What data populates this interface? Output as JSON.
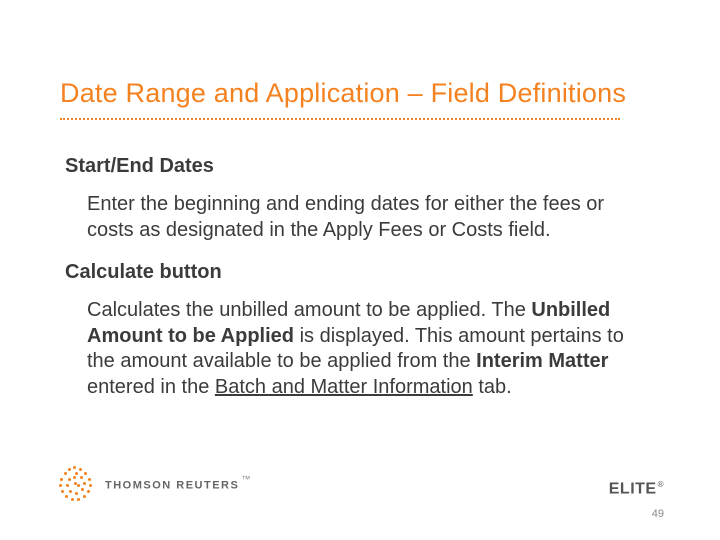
{
  "title": "Date Range and Application – Field Definitions",
  "sections": {
    "s1": {
      "head": "Start/End Dates",
      "p": "Enter the beginning and ending dates for either the fees or costs as designated in the Apply Fees or Costs field."
    },
    "s2": {
      "head": "Calculate button",
      "p_pre": "Calculates the unbilled amount to be applied.  The ",
      "p_b1": "Unbilled Amount to be Applied",
      "p_mid": " is displayed.  This amount pertains to the amount available to be applied from the ",
      "p_b2": "Interim Matter",
      "p_mid2": " entered in the ",
      "p_u": "Batch and Matter Information",
      "p_end": " tab."
    }
  },
  "footer": {
    "left_brand": "THOMSON REUTERS",
    "left_tm": "™",
    "right_brand": "ELITE",
    "right_reg": "®",
    "page": "49"
  }
}
